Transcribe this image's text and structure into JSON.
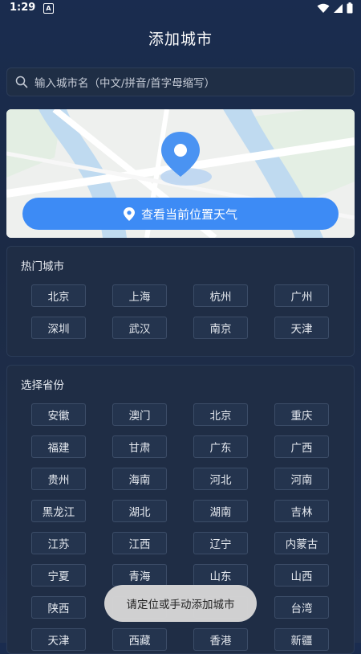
{
  "status": {
    "time": "1:29",
    "a_icon": "A"
  },
  "header": {
    "title": "添加城市"
  },
  "search": {
    "placeholder": "输入城市名（中文/拼音/首字母缩写）"
  },
  "map": {
    "locate_label": "查看当前位置天气"
  },
  "hot": {
    "title": "热门城市",
    "cities": [
      "北京",
      "上海",
      "杭州",
      "广州",
      "深圳",
      "武汉",
      "南京",
      "天津"
    ]
  },
  "provinces": {
    "title": "选择省份",
    "items": [
      "安徽",
      "澳门",
      "北京",
      "重庆",
      "福建",
      "甘肃",
      "广东",
      "广西",
      "贵州",
      "海南",
      "河北",
      "河南",
      "黑龙江",
      "湖北",
      "湖南",
      "吉林",
      "江苏",
      "江西",
      "辽宁",
      "内蒙古",
      "宁夏",
      "青海",
      "山东",
      "山西",
      "陕西",
      "",
      "",
      "台湾",
      "天津",
      "西藏",
      "香港",
      "新疆"
    ]
  },
  "toast": {
    "text": "请定位或手动添加城市"
  },
  "colors": {
    "accent": "#3d8bf5",
    "background": "#1b2a45"
  }
}
